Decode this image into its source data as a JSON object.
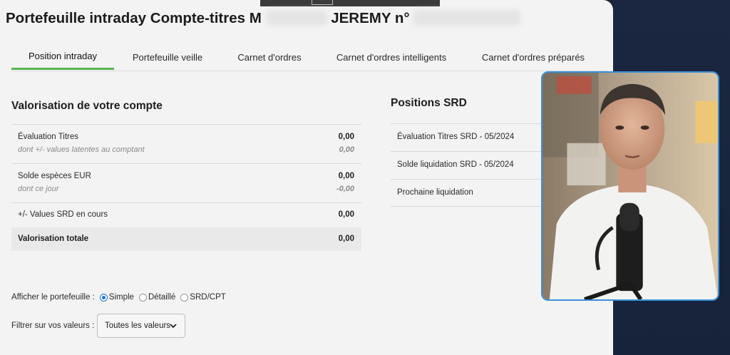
{
  "title": {
    "part1": "Portefeuille intraday Compte-titres M",
    "part2": "JEREMY n°"
  },
  "tabs": [
    {
      "label": "Position intraday",
      "active": true
    },
    {
      "label": "Portefeuille veille",
      "active": false
    },
    {
      "label": "Carnet d'ordres",
      "active": false
    },
    {
      "label": "Carnet d'ordres intelligents",
      "active": false
    },
    {
      "label": "Carnet d'ordres préparés",
      "active": false
    }
  ],
  "valorisation": {
    "title": "Valorisation de votre compte",
    "rows": [
      {
        "label": "Évaluation Titres",
        "value": "0,00",
        "sublabel": "dont +/- values latentes au comptant",
        "subvalue": "0,00"
      },
      {
        "label": "Solde espèces EUR",
        "value": "0,00",
        "sublabel": "dont ce jour",
        "subvalue": "-0,00"
      },
      {
        "label": "+/- Values SRD en cours",
        "value": "0,00"
      },
      {
        "label": "Valorisation totale",
        "value": "0,00"
      }
    ]
  },
  "srd": {
    "title": "Positions SRD",
    "rows": [
      {
        "label": "Évaluation Titres SRD - 05/2024"
      },
      {
        "label": "Solde liquidation SRD - 05/2024"
      },
      {
        "label": "Prochaine liquidation"
      }
    ]
  },
  "display_options": {
    "label": "Afficher le portefeuille :",
    "options": [
      {
        "label": "Simple",
        "selected": true
      },
      {
        "label": "Détaillé",
        "selected": false
      },
      {
        "label": "SRD/CPT",
        "selected": false
      }
    ]
  },
  "filter": {
    "label": "Filtrer sur vos valeurs :",
    "selected": "Toutes les valeurs"
  },
  "colors": {
    "accent_green": "#5ab552",
    "radio_blue": "#1a73e8",
    "webcam_border": "#3a8fd8"
  }
}
